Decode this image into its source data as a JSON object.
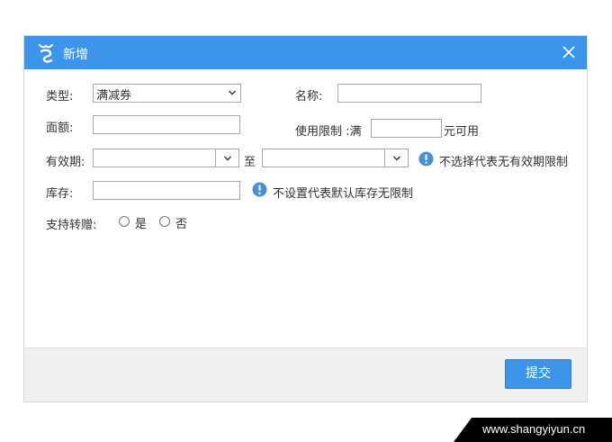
{
  "dialog": {
    "title": "新增",
    "close_icon": "close-icon",
    "logo_icon": "app-logo-icon"
  },
  "form": {
    "type": {
      "label": "类型:",
      "selected": "满减券"
    },
    "name": {
      "label": "名称:",
      "value": ""
    },
    "amount": {
      "label": "面额:",
      "value": ""
    },
    "usage_limit": {
      "label": "使用限制 :满",
      "value": "",
      "suffix": "元可用"
    },
    "validity": {
      "label": "有效期:",
      "start": "",
      "to_label": "至",
      "end": "",
      "hint": "不选择代表无有效期限制"
    },
    "stock": {
      "label": "库存:",
      "value": "",
      "hint": "不设置代表默认库存无限制"
    },
    "transfer": {
      "label": "支持转赠:",
      "option_yes": "是",
      "option_no": "否"
    }
  },
  "footer": {
    "submit_label": "提交"
  },
  "watermark": {
    "text": "www.shangyiyun.cn"
  },
  "colors": {
    "accent": "#3c95e9",
    "info": "#4a8fd6",
    "footer_bg": "#f0f0f0"
  }
}
